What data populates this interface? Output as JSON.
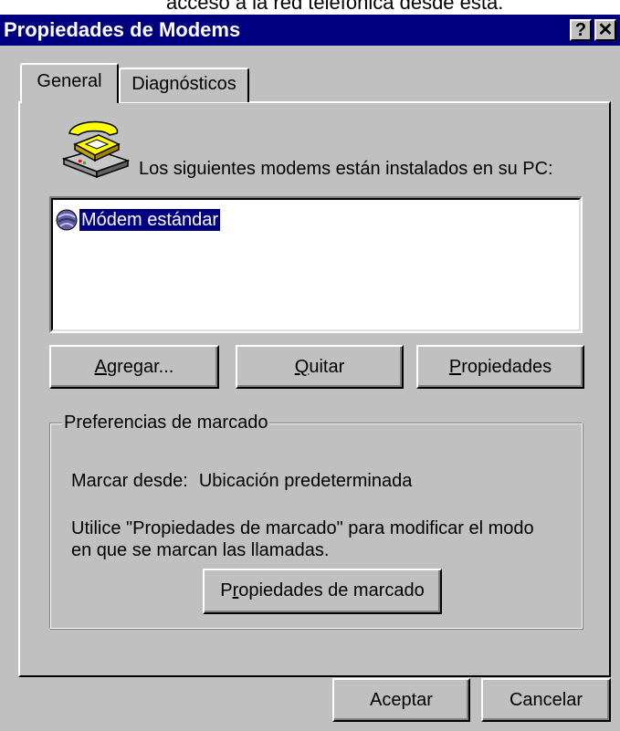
{
  "background": {
    "text": "acceso a la red telefónica desde ésta."
  },
  "window": {
    "title": "Propiedades de Modems",
    "help_label": "?",
    "close_label": "✕"
  },
  "tabs": [
    {
      "label": "General",
      "active": true
    },
    {
      "label": "Diagnósticos",
      "active": false
    }
  ],
  "modems": {
    "header": "Los siguientes modems están instalados en su PC:",
    "icon": "telephone-icon",
    "items": [
      {
        "label": "Módem estándar",
        "icon": "modem-icon",
        "selected": true
      }
    ]
  },
  "buttons": {
    "add": {
      "pre": "",
      "u": "A",
      "post": "gregar..."
    },
    "remove": {
      "pre": "",
      "u": "Q",
      "post": "uitar"
    },
    "properties": {
      "pre": "",
      "u": "P",
      "post": "ropiedades"
    }
  },
  "dialing": {
    "legend": "Preferencias de marcado",
    "from_label": "Marcar desde:",
    "from_value": "Ubicación predeterminada",
    "hint": "Utilice \"Propiedades de marcado\" para modificar el modo en que se marcan las llamadas.",
    "props_button": {
      "pre": "P",
      "u": "r",
      "post": "opiedades de marcado"
    }
  },
  "footer": {
    "ok_label": "Aceptar",
    "cancel_label": "Cancelar"
  },
  "colors": {
    "face": "#c0c0c0",
    "titlebar": "#000080",
    "selection": "#000080"
  }
}
